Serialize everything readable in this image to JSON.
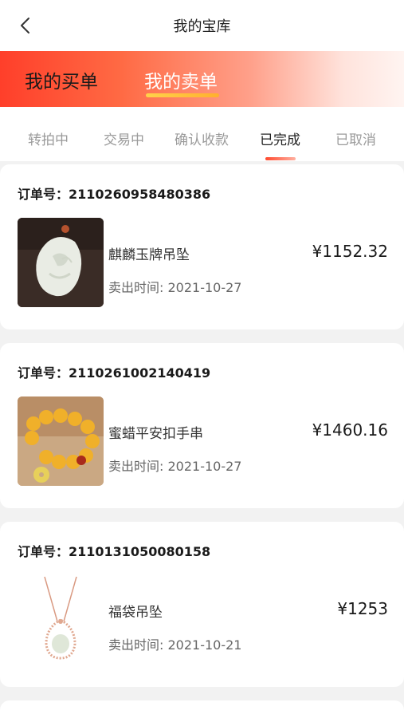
{
  "header": {
    "title": "我的宝库"
  },
  "banner": {
    "tabs": [
      {
        "label": "我的买单"
      },
      {
        "label": "我的卖单"
      }
    ]
  },
  "status_tabs": [
    {
      "label": "转拍中"
    },
    {
      "label": "交易中"
    },
    {
      "label": "确认收款"
    },
    {
      "label": "已完成"
    },
    {
      "label": "已取消"
    }
  ],
  "orders": [
    {
      "order_no": "订单号：2110260958480386",
      "name": "麒麟玉牌吊坠",
      "price": "¥1152.32",
      "sold_time": "卖出时间: 2021-10-27"
    },
    {
      "order_no": "订单号：2110261002140419",
      "name": "蜜蜡平安扣手串",
      "price": "¥1460.16",
      "sold_time": "卖出时间: 2021-10-27"
    },
    {
      "order_no": "订单号：2110131050080158",
      "name": "福袋吊坠",
      "price": "¥1253",
      "sold_time": "卖出时间: 2021-10-21"
    }
  ]
}
